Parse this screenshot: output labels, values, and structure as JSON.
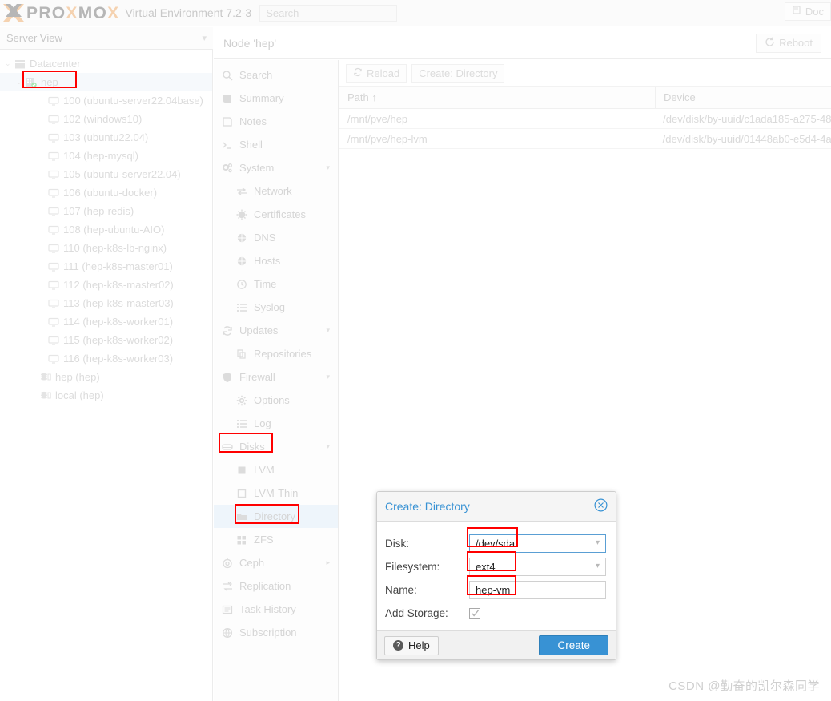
{
  "topbar": {
    "brand": "PROXMOX",
    "brand_letters": [
      {
        "ch": "P",
        "c": "g"
      },
      {
        "ch": "R",
        "c": "g"
      },
      {
        "ch": "O",
        "c": "g"
      },
      {
        "ch": "X",
        "c": "o"
      },
      {
        "ch": "M",
        "c": "g"
      },
      {
        "ch": "O",
        "c": "g"
      },
      {
        "ch": "X",
        "c": "o"
      }
    ],
    "product": "Virtual Environment 7.2-3",
    "search_placeholder": "Search",
    "documentation_label": "Doc",
    "accent_gray": "#b6b6b6",
    "accent_orange": "#f5d2b0"
  },
  "serverview": {
    "label": "Server View"
  },
  "node_header": {
    "title": "Node 'hep'",
    "reboot_label": "Reboot"
  },
  "tree": {
    "items": [
      {
        "label": "Datacenter",
        "depth": 0,
        "icon": "datacenter-icon",
        "twisty": "⌄",
        "selected": false
      },
      {
        "label": "hep",
        "depth": 1,
        "icon": "node-online-icon",
        "twisty": "⌄",
        "selected": true,
        "boxed": true
      },
      {
        "label": "100 (ubuntu-server22.04base)",
        "depth": 2,
        "icon": "vm-icon",
        "twisty": "",
        "selected": false
      },
      {
        "label": "102 (windows10)",
        "depth": 2,
        "icon": "vm-icon",
        "twisty": "",
        "selected": false
      },
      {
        "label": "103 (ubuntu22.04)",
        "depth": 2,
        "icon": "vm-icon",
        "twisty": "",
        "selected": false
      },
      {
        "label": "104 (hep-mysql)",
        "depth": 2,
        "icon": "vm-icon",
        "twisty": "",
        "selected": false
      },
      {
        "label": "105 (ubuntu-server22.04)",
        "depth": 2,
        "icon": "vm-icon",
        "twisty": "",
        "selected": false
      },
      {
        "label": "106 (ubuntu-docker)",
        "depth": 2,
        "icon": "vm-icon",
        "twisty": "",
        "selected": false
      },
      {
        "label": "107 (hep-redis)",
        "depth": 2,
        "icon": "vm-icon",
        "twisty": "",
        "selected": false
      },
      {
        "label": "108 (hep-ubuntu-AIO)",
        "depth": 2,
        "icon": "vm-icon",
        "twisty": "",
        "selected": false
      },
      {
        "label": "110 (hep-k8s-lb-nginx)",
        "depth": 2,
        "icon": "vm-icon",
        "twisty": "",
        "selected": false
      },
      {
        "label": "111 (hep-k8s-master01)",
        "depth": 2,
        "icon": "vm-icon",
        "twisty": "",
        "selected": false
      },
      {
        "label": "112 (hep-k8s-master02)",
        "depth": 2,
        "icon": "vm-icon",
        "twisty": "",
        "selected": false
      },
      {
        "label": "113 (hep-k8s-master03)",
        "depth": 2,
        "icon": "vm-icon",
        "twisty": "",
        "selected": false
      },
      {
        "label": "114 (hep-k8s-worker01)",
        "depth": 2,
        "icon": "vm-icon",
        "twisty": "",
        "selected": false
      },
      {
        "label": "115 (hep-k8s-worker02)",
        "depth": 2,
        "icon": "vm-icon",
        "twisty": "",
        "selected": false
      },
      {
        "label": "116 (hep-k8s-worker03)",
        "depth": 2,
        "icon": "vm-icon",
        "twisty": "",
        "selected": false
      },
      {
        "label": "hep (hep)",
        "depth": 1.5,
        "icon": "storage-icon",
        "twisty": "",
        "selected": false
      },
      {
        "label": "local (hep)",
        "depth": 1.5,
        "icon": "storage-icon",
        "twisty": "",
        "selected": false
      }
    ]
  },
  "nav": {
    "items": [
      {
        "label": "Search",
        "icon": "search-icon",
        "sub": false,
        "arrow": "",
        "active": false
      },
      {
        "label": "Summary",
        "icon": "summary-icon",
        "sub": false,
        "arrow": "",
        "active": false
      },
      {
        "label": "Notes",
        "icon": "notes-icon",
        "sub": false,
        "arrow": "",
        "active": false
      },
      {
        "label": "Shell",
        "icon": "shell-icon",
        "sub": false,
        "arrow": "",
        "active": false
      },
      {
        "label": "System",
        "icon": "system-gears-icon",
        "sub": false,
        "arrow": "▾",
        "active": false
      },
      {
        "label": "Network",
        "icon": "network-icon",
        "sub": true,
        "arrow": "",
        "active": false
      },
      {
        "label": "Certificates",
        "icon": "certificate-icon",
        "sub": true,
        "arrow": "",
        "active": false
      },
      {
        "label": "DNS",
        "icon": "dns-globe-icon",
        "sub": true,
        "arrow": "",
        "active": false
      },
      {
        "label": "Hosts",
        "icon": "hosts-globe-icon",
        "sub": true,
        "arrow": "",
        "active": false
      },
      {
        "label": "Time",
        "icon": "clock-icon",
        "sub": true,
        "arrow": "",
        "active": false
      },
      {
        "label": "Syslog",
        "icon": "list-icon",
        "sub": true,
        "arrow": "",
        "active": false
      },
      {
        "label": "Updates",
        "icon": "refresh-icon",
        "sub": false,
        "arrow": "▾",
        "active": false
      },
      {
        "label": "Repositories",
        "icon": "repositories-icon",
        "sub": true,
        "arrow": "",
        "active": false
      },
      {
        "label": "Firewall",
        "icon": "shield-icon",
        "sub": false,
        "arrow": "▾",
        "active": false
      },
      {
        "label": "Options",
        "icon": "gear-icon",
        "sub": true,
        "arrow": "",
        "active": false
      },
      {
        "label": "Log",
        "icon": "list-icon",
        "sub": true,
        "arrow": "",
        "active": false
      },
      {
        "label": "Disks",
        "icon": "disk-icon",
        "sub": false,
        "arrow": "▾",
        "active": false,
        "boxed": true
      },
      {
        "label": "LVM",
        "icon": "lvm-icon",
        "sub": true,
        "arrow": "",
        "active": false
      },
      {
        "label": "LVM-Thin",
        "icon": "lvm-thin-icon",
        "sub": true,
        "arrow": "",
        "active": false
      },
      {
        "label": "Directory",
        "icon": "folder-icon",
        "sub": true,
        "arrow": "",
        "active": true,
        "boxed": true
      },
      {
        "label": "ZFS",
        "icon": "zfs-icon",
        "sub": true,
        "arrow": "",
        "active": false
      },
      {
        "label": "Ceph",
        "icon": "ceph-icon",
        "sub": false,
        "arrow": "▸",
        "active": false
      },
      {
        "label": "Replication",
        "icon": "replication-icon",
        "sub": false,
        "arrow": "",
        "active": false
      },
      {
        "label": "Task History",
        "icon": "task-history-icon",
        "sub": false,
        "arrow": "",
        "active": false
      },
      {
        "label": "Subscription",
        "icon": "subscription-icon",
        "sub": false,
        "arrow": "",
        "active": false
      }
    ]
  },
  "content": {
    "toolbar": {
      "reload_label": "Reload",
      "create_directory_label": "Create: Directory"
    },
    "table": {
      "columns": [
        "Path ↑",
        "Device"
      ],
      "rows": [
        {
          "path": "/mnt/pve/hep",
          "device": "/dev/disk/by-uuid/c1ada185-a275-48"
        },
        {
          "path": "/mnt/pve/hep-lvm",
          "device": "/dev/disk/by-uuid/01448ab0-e5d4-4a"
        }
      ]
    }
  },
  "dialog": {
    "title": "Create: Directory",
    "close_icon": "close-circle-icon",
    "fields": [
      {
        "label": "Disk:",
        "value": "/dev/sda",
        "type": "select",
        "focused": true
      },
      {
        "label": "Filesystem:",
        "value": "ext4",
        "type": "select",
        "focused": false
      },
      {
        "label": "Name:",
        "value": "hep-vm",
        "type": "text",
        "focused": false
      }
    ],
    "checkbox": {
      "label": "Add Storage:",
      "checked": true
    },
    "help_label": "Help",
    "create_label": "Create",
    "accent_blue": "#3892d4"
  },
  "watermark": {
    "text": "CSDN @勤奋的凯尔森同学"
  }
}
